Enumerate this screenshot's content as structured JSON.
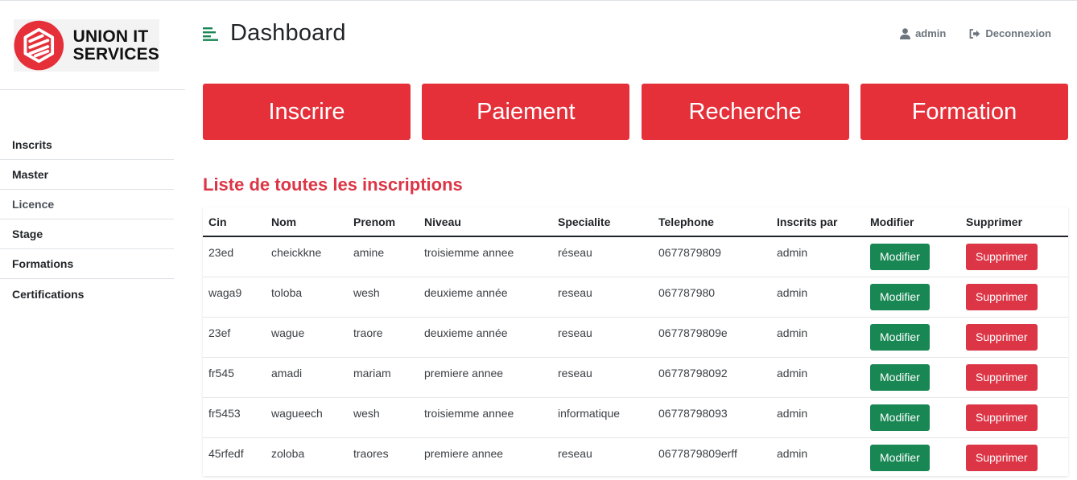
{
  "logo": {
    "text_line1": "UNION IT",
    "text_line2": "SERVICES",
    "brand_color": "#e52f39"
  },
  "sidebar": {
    "items": [
      {
        "label": "Inscrits"
      },
      {
        "label": "Master"
      },
      {
        "label": "Licence"
      },
      {
        "label": "Stage"
      },
      {
        "label": "Formations"
      },
      {
        "label": "Certifications"
      }
    ]
  },
  "header": {
    "title": "Dashboard",
    "user_label": "admin",
    "logout_label": "Deconnexion",
    "menu_icon": "menu-icon",
    "user_icon": "user-icon",
    "logout_icon": "sign-out-icon"
  },
  "actions": [
    {
      "label": "Inscrire"
    },
    {
      "label": "Paiement"
    },
    {
      "label": "Recherche"
    },
    {
      "label": "Formation"
    }
  ],
  "section_title": "Liste de toutes les inscriptions",
  "table": {
    "headers": [
      "Cin",
      "Nom",
      "Prenom",
      "Niveau",
      "Specialite",
      "Telephone",
      "Inscrits par",
      "Modifier",
      "Supprimer"
    ],
    "rows": [
      [
        "23ed",
        "cheickkne",
        "amine",
        "troisiemme annee",
        "réseau",
        "0677879809",
        "admin"
      ],
      [
        "waga9",
        "toloba",
        "wesh",
        "deuxieme année",
        "reseau",
        "067787980",
        "admin"
      ],
      [
        "23ef",
        "wague",
        "traore",
        "deuxieme année",
        "reseau",
        "0677879809e",
        "admin"
      ],
      [
        "fr545",
        "amadi",
        "mariam",
        "premiere annee",
        "reseau",
        "06778798092",
        "admin"
      ],
      [
        "fr5453",
        "wagueech",
        "wesh",
        "troisiemme annee",
        "informatique",
        "06778798093",
        "admin"
      ],
      [
        "45rfedf",
        "zoloba",
        "traores",
        "premiere annee",
        "reseau",
        "0677879809erff",
        "admin"
      ]
    ],
    "modify_label": "Modifier",
    "delete_label": "Supprimer"
  },
  "colors": {
    "primary_red": "#e52f39",
    "danger": "#dc3545",
    "success": "#198754",
    "accent_green": "#198754"
  }
}
